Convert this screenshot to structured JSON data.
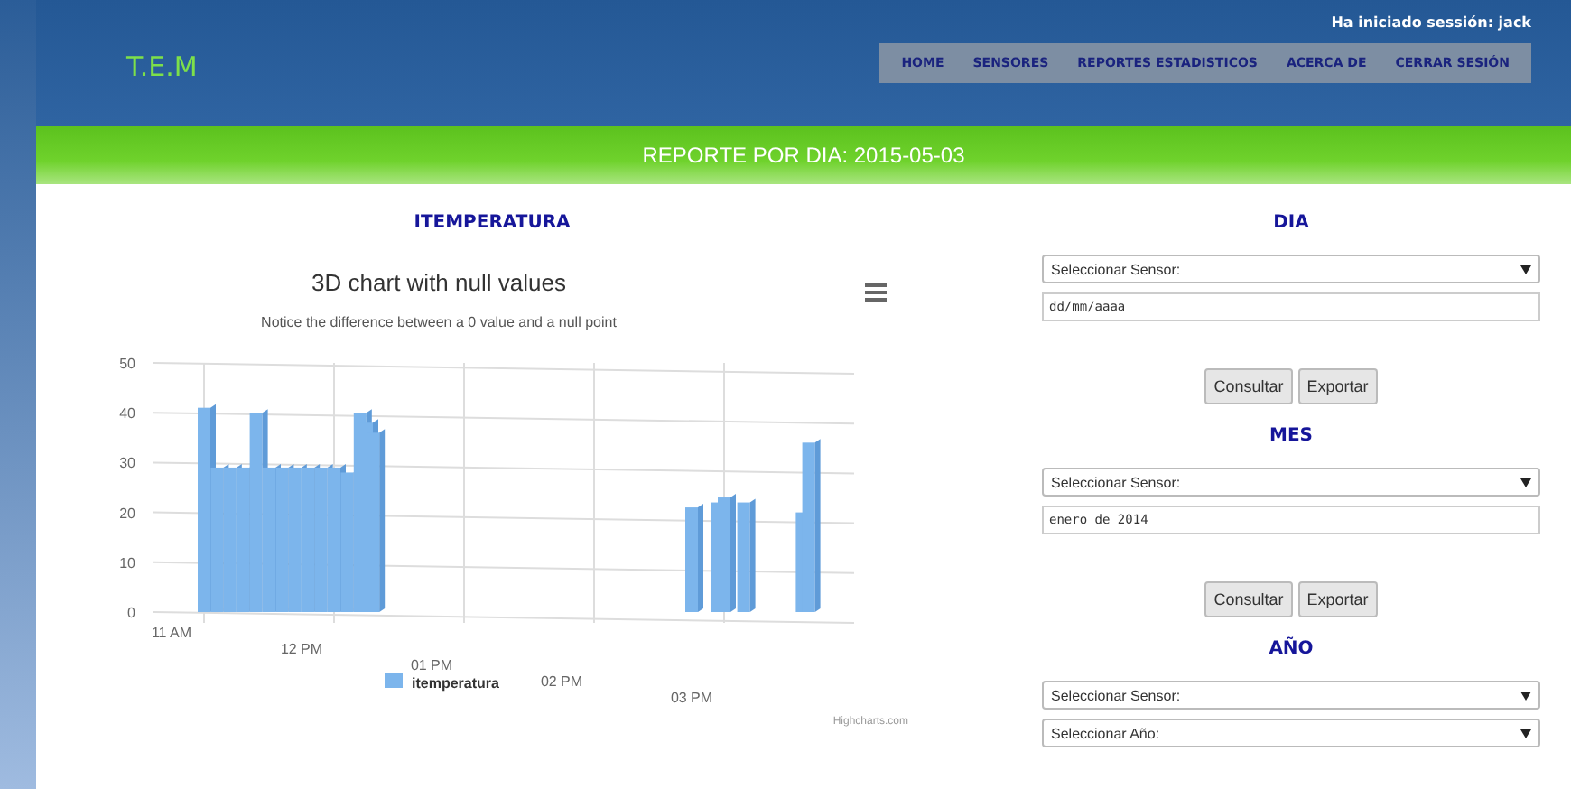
{
  "header": {
    "logo": "T.E.M",
    "session": "Ha iniciado sessión: jack",
    "nav": [
      {
        "label": "HOME"
      },
      {
        "label": "SENSORES"
      },
      {
        "label": "REPORTES ESTADISTICOS"
      },
      {
        "label": "ACERCA DE"
      },
      {
        "label": "CERRAR SESIÓN"
      }
    ]
  },
  "banner": "REPORTE POR DIA: 2015-05-03",
  "chart_panel": {
    "heading": "ITEMPERATURA",
    "subtitle": "Notice the difference between a 0 value and a null point",
    "credits": "Highcharts.com",
    "chart_title": "3D chart with null values",
    "legend": "itemperatura",
    "y_axis_labels": [
      "50",
      "40",
      "30",
      "20",
      "10",
      "0"
    ],
    "x_axis_labels": [
      "11 AM",
      "12 PM",
      "01 PM",
      "02 PM",
      "03 PM"
    ]
  },
  "forms": [
    {
      "heading": "DIA",
      "fields": [
        {
          "kind": "select",
          "value": "Seleccionar Sensor:"
        },
        {
          "kind": "text",
          "value": "dd/mm/aaaa"
        }
      ],
      "buttons": [
        "Consultar",
        "Exportar"
      ]
    },
    {
      "heading": "MES",
      "fields": [
        {
          "kind": "select",
          "value": "Seleccionar Sensor:"
        },
        {
          "kind": "text",
          "value": "enero de 2014"
        }
      ],
      "buttons": [
        "Consultar",
        "Exportar"
      ]
    },
    {
      "heading": "AÑO",
      "fields": [
        {
          "kind": "select",
          "value": "Seleccionar Sensor:"
        },
        {
          "kind": "select",
          "value": "Seleccionar Año:"
        }
      ]
    }
  ]
}
